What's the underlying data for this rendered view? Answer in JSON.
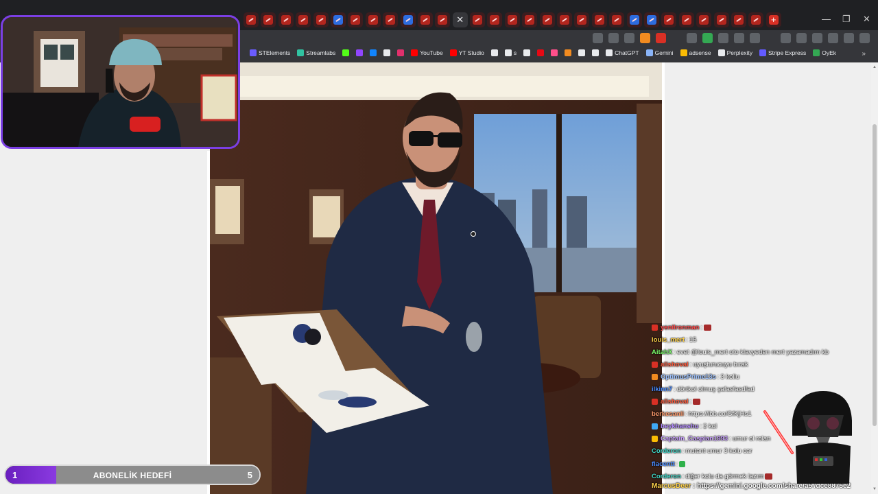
{
  "browser": {
    "tab_count": 30,
    "window_controls": {
      "minimize": "—",
      "maximize": "❐",
      "close": "✕"
    },
    "new_tab_label": "+",
    "active_tab_close": "✕",
    "bookmarks": [
      {
        "label": "STElements",
        "color": "#6a5cff"
      },
      {
        "label": "Streamlabs",
        "color": "#31c3a2"
      },
      {
        "label": "",
        "color": "#53fc18"
      },
      {
        "label": "",
        "color": "#9146ff"
      },
      {
        "label": "",
        "color": "#1185fe"
      },
      {
        "label": "",
        "color": "#e8eaed"
      },
      {
        "label": "",
        "color": "#e1306c"
      },
      {
        "label": "YouTube",
        "color": "#ff0000"
      },
      {
        "label": "YT Studio",
        "color": "#ff0000"
      },
      {
        "label": "",
        "color": "#e8eaed"
      },
      {
        "label": "s",
        "color": "#e8eaed"
      },
      {
        "label": "",
        "color": "#e8eaed"
      },
      {
        "label": "",
        "color": "#e50914"
      },
      {
        "label": "",
        "color": "#ff4f8b"
      },
      {
        "label": "",
        "color": "#f28b20"
      },
      {
        "label": "",
        "color": "#e8eaed"
      },
      {
        "label": "",
        "color": "#e8eaed"
      },
      {
        "label": "ChatGPT",
        "color": "#e8eaed"
      },
      {
        "label": "Gemini",
        "color": "#8ab4f8"
      },
      {
        "label": "adsense",
        "color": "#fbbc04"
      },
      {
        "label": "Perplexity",
        "color": "#e8eaed"
      },
      {
        "label": "Stripe Express",
        "color": "#635bff"
      },
      {
        "label": "OyEk",
        "color": "#34a853"
      }
    ],
    "bookmarks_more": "»"
  },
  "goal": {
    "current": "1",
    "title": "ABONELİK HEDEFİ",
    "target": "5",
    "progress_fraction": 0.2
  },
  "chat": {
    "messages": [
      {
        "user": "yenilronman",
        "text": "",
        "color": "#ff4a4a",
        "badge": "#d93025",
        "emote": true
      },
      {
        "user": "louis_mert",
        "text": "15",
        "color": "#ffd24a",
        "badge": "",
        "emote": false
      },
      {
        "user": "AitahX",
        "text": "evet @louis_mert oto klavyeden mert yazamadım kb",
        "color": "#7cff6b",
        "badge": "",
        "emote": false
      },
      {
        "user": "alishoval",
        "text": "uyuşturucuyu bırak",
        "color": "#ff5a3c",
        "badge": "#d93025",
        "emote": false
      },
      {
        "user": "OptimusPrime13s",
        "text": "3 kollu",
        "color": "#9fc3ff",
        "badge": "#f28b20",
        "emote": false
      },
      {
        "user": "ilkinn7",
        "text": "dörtkol olmuş şafasfasdfad",
        "color": "#4a8bff",
        "badge": "",
        "emote": false
      },
      {
        "user": "alishoval",
        "text": "",
        "color": "#ff5a3c",
        "badge": "#d93025",
        "emote": true
      },
      {
        "user": "berkesanli",
        "text": "https://ibb.co/GfKjHs1",
        "color": "#ff9a6b",
        "badge": "",
        "emote": false
      },
      {
        "user": "beykhanshu",
        "text": "3 kol",
        "color": "#b48cff",
        "badge": "#3fa9f5",
        "emote": false
      },
      {
        "user": "Captain_Caspian1993",
        "text": "umur ol rolan",
        "color": "#c9a0ff",
        "badge": "#fbbc04",
        "emote": false
      },
      {
        "user": "Corderon",
        "text": "mutant umur 3 kolu car",
        "color": "#3fd6c6",
        "badge": "",
        "emote": false
      },
      {
        "user": "flacentt",
        "text": "",
        "color": "#4a8bff",
        "badge": "",
        "emote": true,
        "emote_color": "green"
      },
      {
        "user": "Corderon",
        "text": "diğer kolu da görmek lazım",
        "color": "#3fd6c6",
        "badge": "",
        "emote": true
      }
    ],
    "last": {
      "user": "MarcusDeer",
      "text": "https://gemini.google.com/share/a5 /dce8875e2",
      "color": "#ffd24a"
    }
  }
}
